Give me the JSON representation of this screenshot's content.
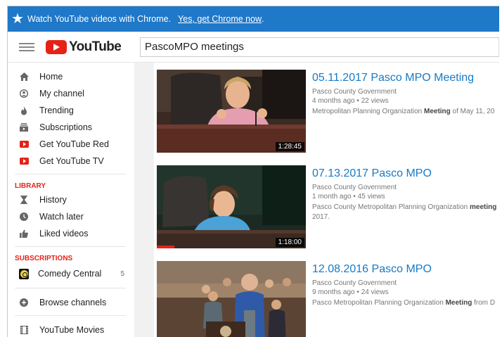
{
  "banner": {
    "star_icon": "star-icon",
    "message": "Watch YouTube videos with Chrome.",
    "link": "Yes, get Chrome now",
    "trailing": "."
  },
  "header": {
    "logo_text": "YouTube",
    "search_value": "PascoMPO meetings"
  },
  "sidebar": {
    "main_items": [
      {
        "label": "Home",
        "icon": "home-icon"
      },
      {
        "label": "My channel",
        "icon": "person-icon"
      },
      {
        "label": "Trending",
        "icon": "flame-icon"
      },
      {
        "label": "Subscriptions",
        "icon": "subscriptions-icon"
      },
      {
        "label": "Get YouTube Red",
        "icon": "red-play-icon"
      },
      {
        "label": "Get YouTube TV",
        "icon": "red-play-icon"
      }
    ],
    "library_heading": "LIBRARY",
    "library_items": [
      {
        "label": "History",
        "icon": "hourglass-icon"
      },
      {
        "label": "Watch later",
        "icon": "clock-icon"
      },
      {
        "label": "Liked videos",
        "icon": "thumbs-up-icon"
      }
    ],
    "subscriptions_heading": "SUBSCRIPTIONS",
    "subscription_items": [
      {
        "label": "Comedy Central",
        "count": "5",
        "icon": "comedy-central-icon"
      }
    ],
    "browse_label": "Browse channels",
    "movies_label": "YouTube Movies"
  },
  "results": [
    {
      "title": "05.11.2017 Pasco MPO Meeting",
      "channel": "Pasco County Government",
      "age": "4 months ago",
      "views": "22 views",
      "desc_pre": "Metropolitan Planning Organization ",
      "desc_bold": "Meeting",
      "desc_post": " of May 11, 20",
      "desc_line2": "",
      "duration": "1:28:45",
      "progress": 0
    },
    {
      "title": "07.13.2017 Pasco MPO",
      "channel": "Pasco County Government",
      "age": "1 month ago",
      "views": "45 views",
      "desc_pre": "Pasco County Metropolitan Planning Organization ",
      "desc_bold": "meeting",
      "desc_post": "",
      "desc_line2": "2017.",
      "duration": "1:18:00",
      "progress": 0.12
    },
    {
      "title": "12.08.2016 Pasco MPO",
      "channel": "Pasco County Government",
      "age": "9 months ago",
      "views": "24 views",
      "desc_pre": "Pasco Metropolitan Planning Organization ",
      "desc_bold": "Meeting",
      "desc_post": " from D",
      "desc_line2": "",
      "duration": "",
      "progress": 0
    }
  ],
  "meta_separator": "•",
  "colors": {
    "banner": "#1f78c8",
    "accent_red": "#e62117",
    "link_blue": "#167ac6"
  }
}
